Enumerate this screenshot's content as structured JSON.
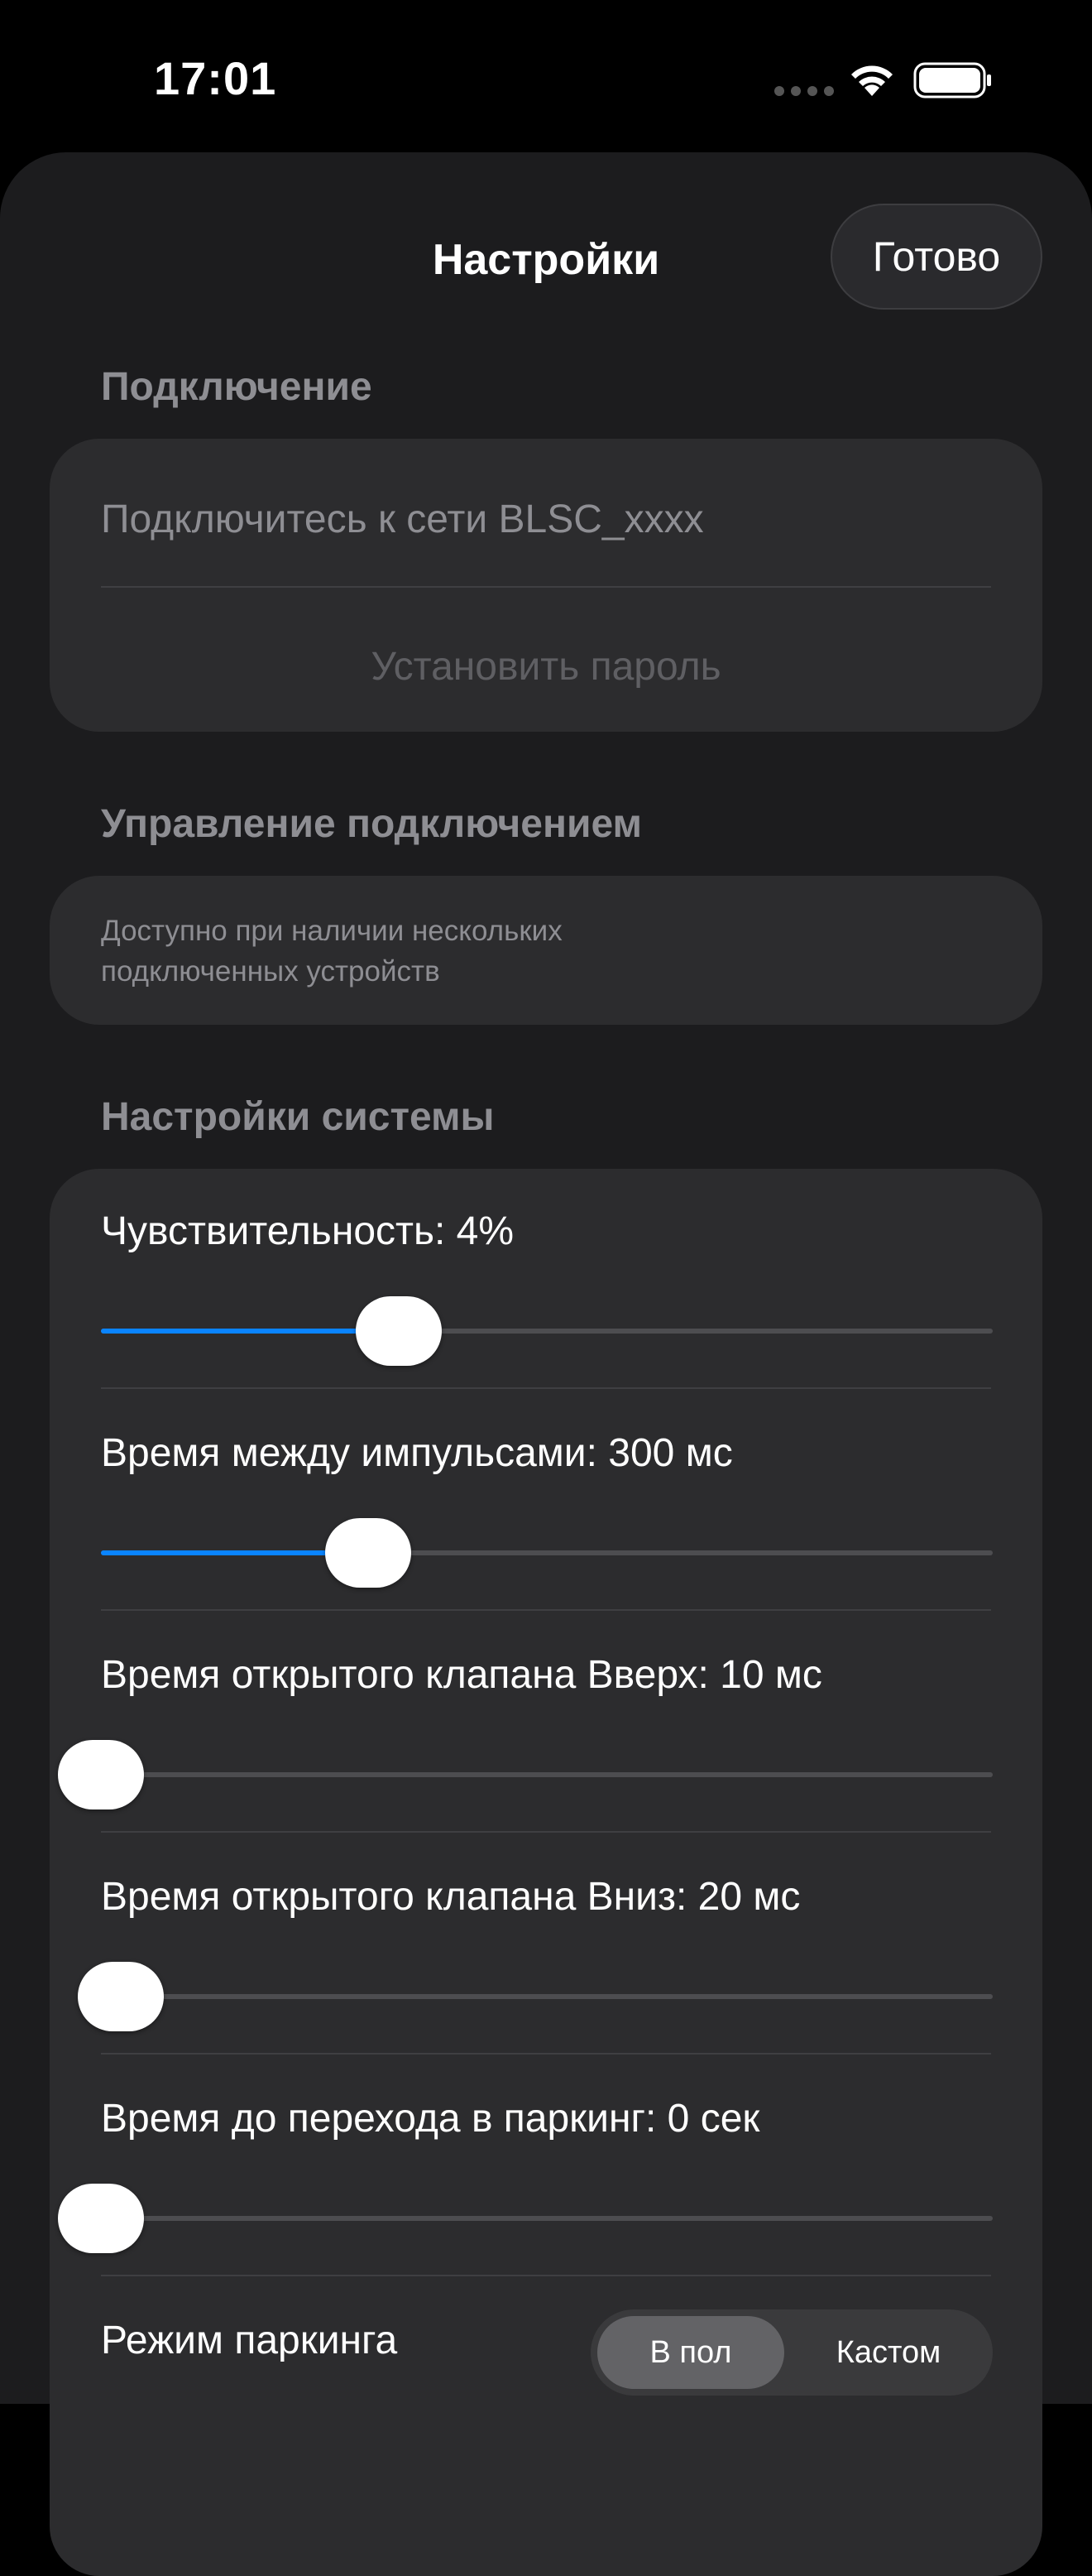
{
  "status_bar": {
    "time": "17:01"
  },
  "header": {
    "title": "Настройки",
    "done_label": "Готово"
  },
  "connection": {
    "header": "Подключение",
    "network_hint": "Подключитесь к сети BLSC_xxxx",
    "set_password_label": "Установить пароль"
  },
  "connection_management": {
    "header": "Управление подключением",
    "note": "Доступно при наличии нескольких подключенных устройств"
  },
  "system": {
    "header": "Настройки системы",
    "sliders": [
      {
        "label": "Чувствительность: 4%",
        "fraction": 0.334
      },
      {
        "label": "Время между импульсами: 300 мс",
        "fraction": 0.3
      },
      {
        "label": "Время открытого клапана Вверх: 10 мс",
        "fraction": 0.0
      },
      {
        "label": "Время открытого клапана Вниз: 20 мс",
        "fraction": 0.022
      },
      {
        "label": "Время до перехода в паркинг: 0 сек",
        "fraction": 0.0
      }
    ],
    "parking_mode": {
      "label": "Режим паркинга",
      "options": [
        "В пол",
        "Кастом"
      ],
      "selected": "В пол"
    }
  },
  "colors": {
    "accent": "#0a84ff",
    "background": "#000000",
    "sheet": "#1c1c1e",
    "card": "#2c2c2e",
    "secondary_text": "#8e8e93"
  },
  "icons": [
    "wifi-icon",
    "battery-icon"
  ]
}
